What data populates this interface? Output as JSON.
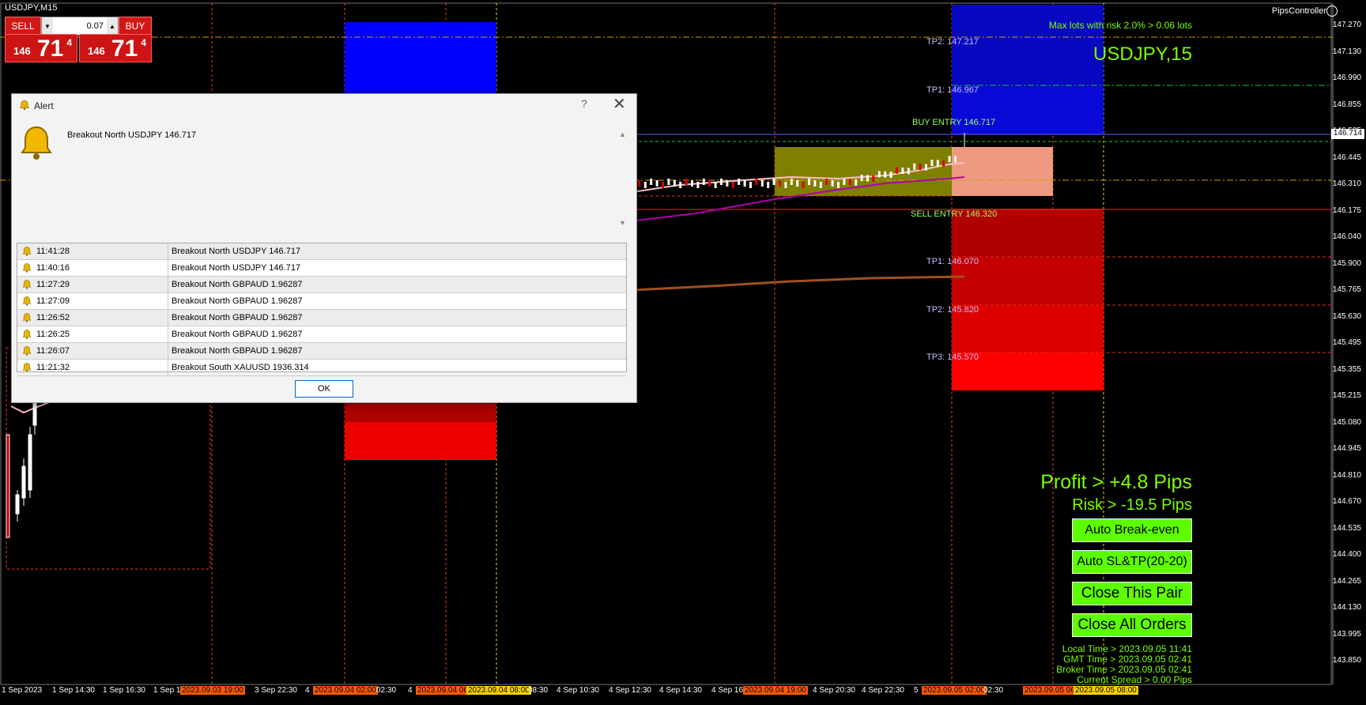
{
  "window": {
    "symbol_title": "USDJPY,M15",
    "indicator_name": "PipsController"
  },
  "trade_panel": {
    "sell_label": "SELL",
    "buy_label": "BUY",
    "lot": "0.07",
    "sell": {
      "small": "146",
      "big": "71",
      "pip": "4"
    },
    "buy": {
      "small": "146",
      "big": "71",
      "pip": "4"
    }
  },
  "colors": {
    "profit_green": "#7cff00",
    "button_green": "#5cff00",
    "buy_zone": "#0a0ad8",
    "sell_zone": "#b00000"
  },
  "overlay": {
    "max_lots": "Max lots with risk 2.0% > 0.06 lots",
    "pair": "USDJPY,15",
    "profit": "Profit > +4.8 Pips",
    "risk": "Risk > -19.5 Pips",
    "buttons": [
      "Auto Break-even",
      "Auto SL&TP(20-20)",
      "Close This Pair",
      "Close All Orders"
    ],
    "local_time": "Local Time > 2023.09.05 11:41",
    "gmt_time": "GMT Time > 2023.09.05 02:41",
    "broker_time": "Broker Time > 2023.09.05 02:41",
    "spread": "Current Spread >  0.00 Pips"
  },
  "levels": {
    "tp2_buy": "TP2: 147.217",
    "tp1_buy": "TP1: 146.967",
    "buy_entry": "BUY ENTRY 146.717",
    "sell_entry": "SELL ENTRY 146.320",
    "tp1_sell": "TP1: 146.070",
    "tp2_sell": "TP2: 145.820",
    "tp3_sell": "TP3: 145.570"
  },
  "price_scale": [
    "147.270",
    "147.130",
    "146.990",
    "146.855",
    "146.585",
    "146.445",
    "146.310",
    "146.175",
    "146.040",
    "145.900",
    "145.765",
    "145.630",
    "145.495",
    "145.355",
    "145.215",
    "145.080",
    "144.945",
    "144.810",
    "144.670",
    "144.535",
    "144.400",
    "144.265",
    "144.130",
    "143.995",
    "143.850"
  ],
  "current_price": "146.714",
  "time_axis": [
    {
      "t": "1 Sep 2023",
      "s": ""
    },
    {
      "t": "1 Sep 14:30",
      "s": ""
    },
    {
      "t": "1 Sep 16:30",
      "s": ""
    },
    {
      "t": "1 Sep 1",
      "s": ""
    },
    {
      "t": "2023.09.03 19:00",
      "s": "o"
    },
    {
      "t": "3 Sep 22:30",
      "s": ""
    },
    {
      "t": "4",
      "s": ""
    },
    {
      "t": "2023.09.04 02:00",
      "s": "o"
    },
    {
      "t": "02:30",
      "s": ""
    },
    {
      "t": "4",
      "s": ""
    },
    {
      "t": "2023.09.04 06",
      "s": "o"
    },
    {
      "t": "2023.09.04 08:00",
      "s": "y"
    },
    {
      "t": "08:30",
      "s": ""
    },
    {
      "t": "4 Sep 10:30",
      "s": ""
    },
    {
      "t": "4 Sep 12:30",
      "s": ""
    },
    {
      "t": "4 Sep 14:30",
      "s": ""
    },
    {
      "t": "4 Sep 16:",
      "s": ""
    },
    {
      "t": "2023.09.04 19:00",
      "s": "o"
    },
    {
      "t": "4 Sep 20:30",
      "s": ""
    },
    {
      "t": "4 Sep 22:30",
      "s": ""
    },
    {
      "t": "5",
      "s": ""
    },
    {
      "t": "2023.09.05 02:00",
      "s": "o"
    },
    {
      "t": "02:30",
      "s": ""
    },
    {
      "t": "2023.09.05 06",
      "s": "o"
    },
    {
      "t": "2023.09.05 08:00",
      "s": "y"
    }
  ],
  "alert": {
    "title": "Alert",
    "help": "?",
    "close": "✕",
    "message": "Breakout North USDJPY 146.717",
    "rows": [
      {
        "time": "11:41:28",
        "text": "Breakout North USDJPY 146.717"
      },
      {
        "time": "11:40:16",
        "text": "Breakout North USDJPY 146.717"
      },
      {
        "time": "11:27:29",
        "text": "Breakout North GBPAUD 1.96287"
      },
      {
        "time": "11:27:09",
        "text": "Breakout North GBPAUD 1.96287"
      },
      {
        "time": "11:26:52",
        "text": "Breakout North GBPAUD 1.96287"
      },
      {
        "time": "11:26:25",
        "text": "Breakout North GBPAUD 1.96287"
      },
      {
        "time": "11:26:07",
        "text": "Breakout North GBPAUD 1.96287"
      },
      {
        "time": "11:21:32",
        "text": "Breakout South XAUUSD 1936.314"
      }
    ],
    "ok": "OK"
  }
}
